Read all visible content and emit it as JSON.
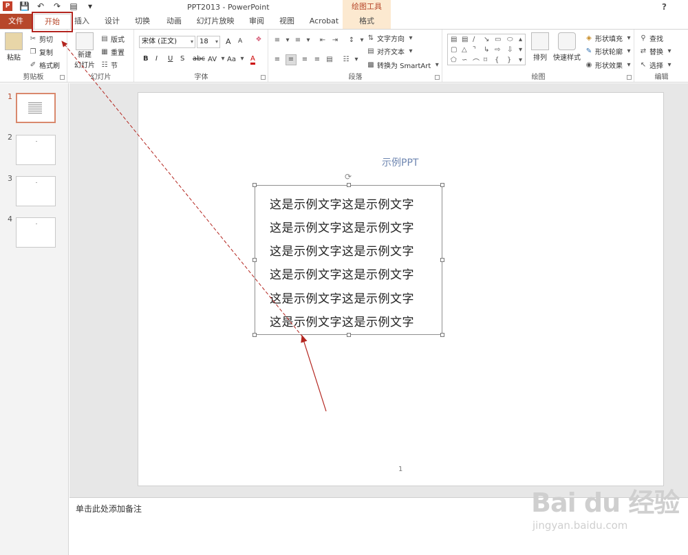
{
  "app": {
    "title": "PPT2013 - PowerPoint",
    "contextual_title": "绘图工具",
    "help": "?"
  },
  "tabs": [
    "文件",
    "开始",
    "插入",
    "设计",
    "切换",
    "动画",
    "幻灯片放映",
    "审阅",
    "视图",
    "Acrobat",
    "格式"
  ],
  "ribbon": {
    "clipboard": {
      "paste": "粘贴",
      "cut": "剪切",
      "copy": "复制",
      "format_painter": "格式刷",
      "group": "剪贴板"
    },
    "slides": {
      "new_slide": "新建",
      "new_slide2": "幻灯片",
      "layout": "版式",
      "reset": "重置",
      "section": "节",
      "group": "幻灯片"
    },
    "font": {
      "name": "宋体 (正文)",
      "size": "18",
      "group": "字体",
      "bold": "B",
      "italic": "I",
      "underline": "U",
      "shadow": "S",
      "strike": "abc",
      "spacing": "AV",
      "case": "Aa",
      "color": "A",
      "grow": "A",
      "shrink": "A"
    },
    "paragraph": {
      "text_direction": "文字方向",
      "align_text": "对齐文本",
      "smartart": "转换为 SmartArt",
      "group": "段落"
    },
    "drawing": {
      "arrange": "排列",
      "quick_styles": "快速样式",
      "fill": "形状填充",
      "outline": "形状轮廓",
      "effects": "形状效果",
      "group": "绘图"
    },
    "editing": {
      "find": "查找",
      "replace": "替换",
      "select": "选择",
      "group": "编辑"
    }
  },
  "slides_panel": [
    "1",
    "2",
    "3",
    "4"
  ],
  "slide": {
    "title": "示例PPT",
    "lines": [
      "这是示例文字这是示例文字",
      "这是示例文字这是示例文字",
      "这是示例文字这是示例文字",
      "这是示例文字这是示例文字",
      "这是示例文字这是示例文字",
      "这是示例文字这是示例文字"
    ],
    "page_number": "1"
  },
  "notes": {
    "placeholder": "单击此处添加备注"
  },
  "watermark": {
    "brand": "Bai du 经验",
    "url": "jingyan.baidu.com"
  },
  "colors": {
    "accent": "#b7472a",
    "annotation": "#b3241e"
  }
}
